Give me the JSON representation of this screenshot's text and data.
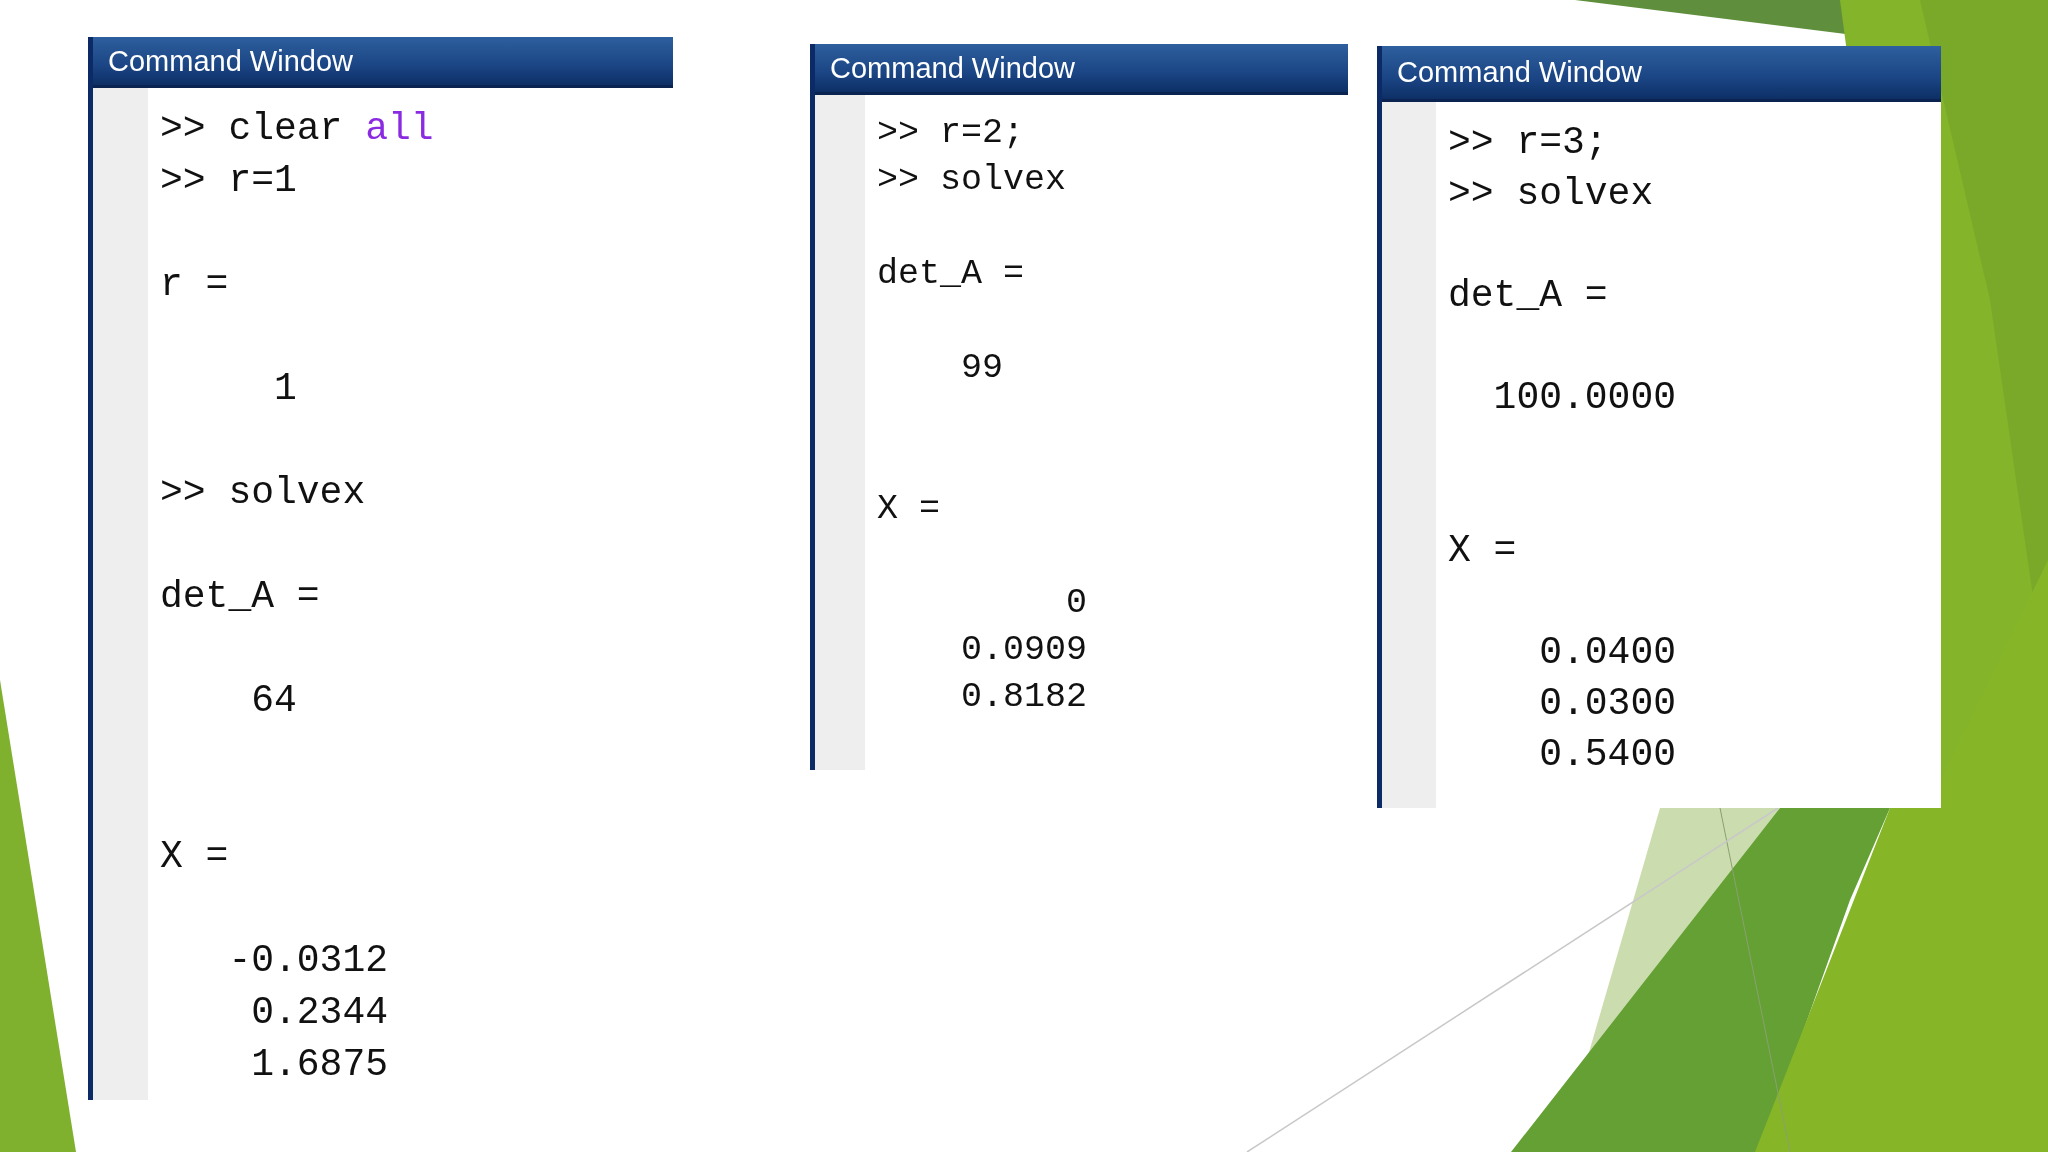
{
  "slide": {
    "windows": [
      {
        "title": "Command Window",
        "lines": [
          {
            "kind": "command",
            "prompt": ">>",
            "text": "clear",
            "keyword": "all"
          },
          {
            "kind": "command",
            "prompt": ">>",
            "text": "r=1"
          },
          {
            "kind": "label",
            "text": "r ="
          },
          {
            "kind": "value",
            "text": "1"
          },
          {
            "kind": "command",
            "prompt": ">>",
            "text": "solvex"
          },
          {
            "kind": "label",
            "text": "det_A ="
          },
          {
            "kind": "value",
            "text": "64"
          },
          {
            "kind": "label",
            "text": "X ="
          },
          {
            "kind": "value",
            "text": "-0.0312"
          },
          {
            "kind": "value",
            "text": "0.2344"
          },
          {
            "kind": "value",
            "text": "1.6875"
          }
        ]
      },
      {
        "title": "Command Window",
        "lines": [
          {
            "kind": "command",
            "prompt": ">>",
            "text": "r=2;"
          },
          {
            "kind": "command",
            "prompt": ">>",
            "text": "solvex"
          },
          {
            "kind": "label",
            "text": "det_A ="
          },
          {
            "kind": "value",
            "text": "99"
          },
          {
            "kind": "label",
            "text": "X ="
          },
          {
            "kind": "value",
            "text": "0"
          },
          {
            "kind": "value",
            "text": "0.0909"
          },
          {
            "kind": "value",
            "text": "0.8182"
          }
        ]
      },
      {
        "title": "Command Window",
        "lines": [
          {
            "kind": "command",
            "prompt": ">>",
            "text": "r=3;"
          },
          {
            "kind": "command",
            "prompt": ">>",
            "text": "solvex"
          },
          {
            "kind": "label",
            "text": "det_A ="
          },
          {
            "kind": "value",
            "text": "100.0000"
          },
          {
            "kind": "label",
            "text": "X ="
          },
          {
            "kind": "value",
            "text": "0.0400"
          },
          {
            "kind": "value",
            "text": "0.0300"
          },
          {
            "kind": "value",
            "text": "0.5400"
          }
        ]
      }
    ]
  }
}
